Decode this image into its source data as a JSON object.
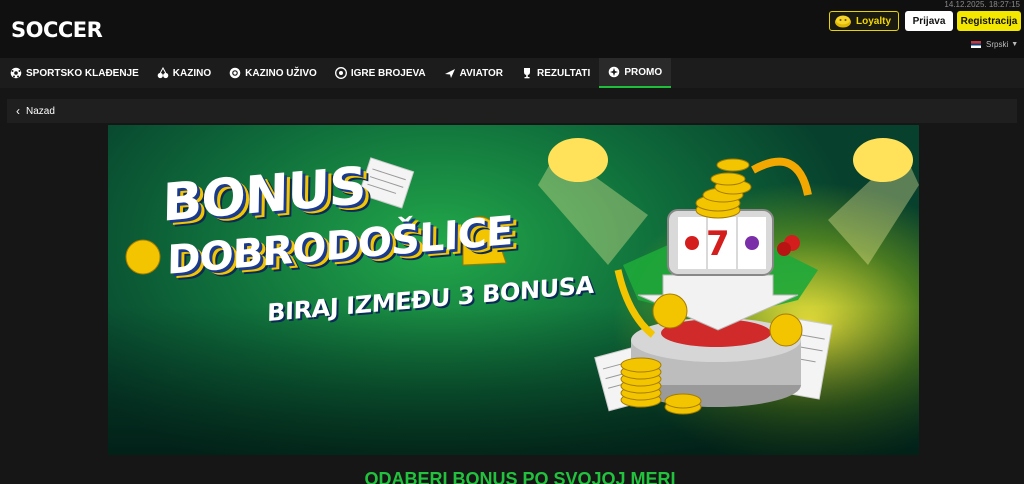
{
  "header": {
    "logo_text": "SOCCER",
    "datetime": "14.12.2025. 18:27:15",
    "loyalty_label": "Loyalty",
    "login_label": "Prijava",
    "register_label": "Registracija",
    "language": "Srpski"
  },
  "nav": {
    "items": [
      {
        "label": "SPORTSKO KLAĐENJE",
        "icon": "soccer-ball-icon"
      },
      {
        "label": "KAZINO",
        "icon": "cherries-icon"
      },
      {
        "label": "KAZINO UŽIVO",
        "icon": "chip-icon"
      },
      {
        "label": "IGRE BROJEVA",
        "icon": "lottery-ball-icon"
      },
      {
        "label": "AVIATOR",
        "icon": "plane-icon"
      },
      {
        "label": "REZULTATI",
        "icon": "trophy-icon"
      },
      {
        "label": "PROMO",
        "icon": "gift-icon",
        "active": true
      }
    ]
  },
  "back": {
    "label": "Nazad"
  },
  "banner": {
    "line1": "BONUS",
    "line2": "DOBRODOŠLICE",
    "line3": "BIRAJ IZMEĐU 3 BONUSA"
  },
  "promo_headline": "ODABERI BONUS PO SVOJOJ MERI",
  "colors": {
    "accent_yellow": "#f3e600",
    "accent_green": "#1fbf3c",
    "background": "#161616"
  }
}
